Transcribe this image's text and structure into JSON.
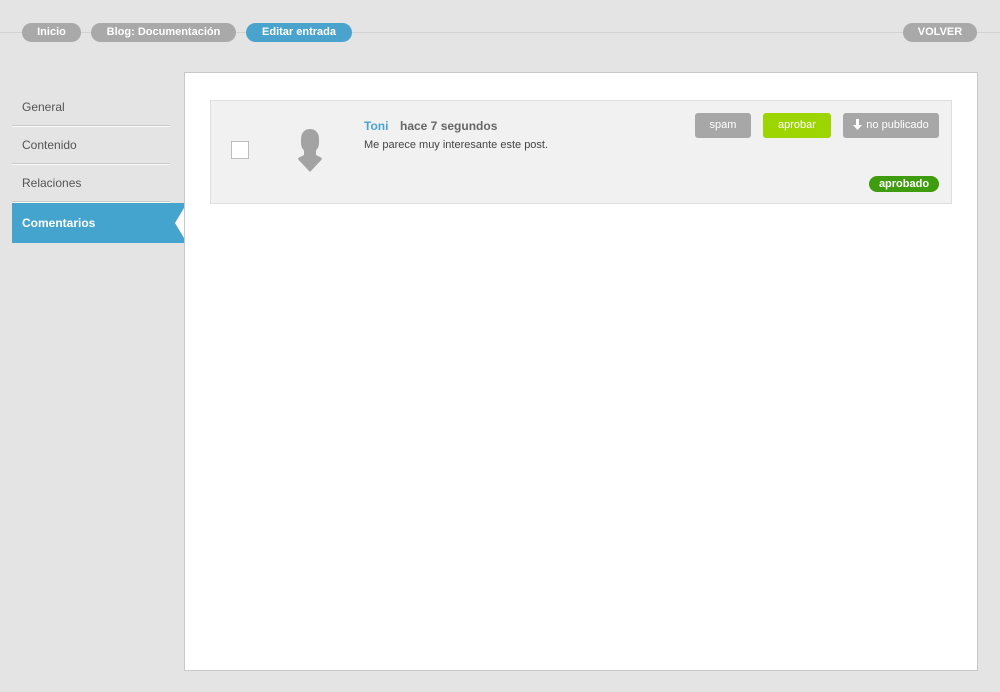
{
  "breadcrumb": {
    "items": [
      {
        "label": "Inicio"
      },
      {
        "label": "Blog: Documentación"
      },
      {
        "label": "Editar entrada"
      }
    ],
    "back_label": "VOLVER"
  },
  "sidebar": {
    "items": [
      {
        "label": "General"
      },
      {
        "label": "Contenido"
      },
      {
        "label": "Relaciones"
      },
      {
        "label": "Comentarios",
        "active": true
      }
    ]
  },
  "comment": {
    "author": "Toni",
    "time": "hace 7 segundos",
    "text": "Me parece muy interesante este post.",
    "avatar_icon": "user-silhouette-icon",
    "buttons": {
      "spam": "spam",
      "approve": "aprobar",
      "unpublished": "no publicado",
      "unpublished_icon": "arrow-down-icon"
    },
    "status_badge": "aprobado"
  },
  "colors": {
    "accent_blue": "#4aa3cd",
    "approve_green": "#9dd500",
    "status_green": "#3e9c0e",
    "neutral_grey": "#a7a7a7"
  }
}
